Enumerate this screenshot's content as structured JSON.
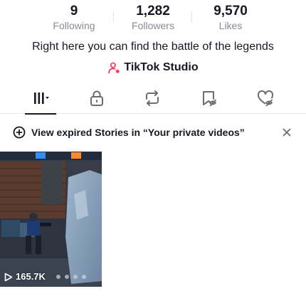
{
  "stats": [
    {
      "value": "9",
      "label": "Following"
    },
    {
      "value": "1,282",
      "label": "Followers"
    },
    {
      "value": "9,570",
      "label": "Likes"
    }
  ],
  "bio": "Right here you can find the battle of the legends",
  "studio": {
    "label": "TikTok Studio",
    "icon": "person-star-icon"
  },
  "tabs": [
    {
      "icon": "videos-grid-icon",
      "active": true
    },
    {
      "icon": "lock-icon",
      "active": false
    },
    {
      "icon": "repost-icon",
      "active": false
    },
    {
      "icon": "bookmark-hidden-icon",
      "active": false
    },
    {
      "icon": "heart-hidden-icon",
      "active": false
    }
  ],
  "banner": {
    "text": "View expired Stories in “Your private videos”",
    "icon": "add-circle-icon",
    "close_icon": "close-icon"
  },
  "videos": [
    {
      "views": "165.7K",
      "icon": "play-icon"
    }
  ],
  "colors": {
    "accent": "#fe2c55",
    "text": "#161823",
    "muted": "#8a8b91"
  }
}
